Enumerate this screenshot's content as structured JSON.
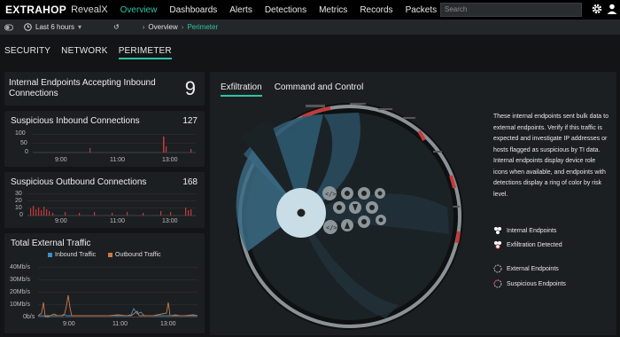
{
  "topbar": {
    "brand": "EXTRAHOP",
    "product": "RevealX",
    "nav": [
      "Overview",
      "Dashboards",
      "Alerts",
      "Detections",
      "Metrics",
      "Records",
      "Packets"
    ],
    "search_placeholder": "Search"
  },
  "subbar": {
    "time_range": "Last 6 hours",
    "crumb_overview": "Overview",
    "crumb_current": "Perimeter"
  },
  "tabs": [
    "SECURITY",
    "NETWORK",
    "PERIMETER"
  ],
  "panels": {
    "inbound_endpoints": {
      "title": "Internal Endpoints Accepting Inbound Connections",
      "count": "9"
    },
    "susp_inbound": {
      "title": "Suspicious Inbound Connections",
      "count": "127",
      "yticks": [
        "100",
        "50",
        "0"
      ],
      "xticks": [
        "9:00",
        "11:00",
        "13:00"
      ]
    },
    "susp_outbound": {
      "title": "Suspicious Outbound Connections",
      "count": "168",
      "yticks": [
        "30",
        "20",
        "10",
        "0"
      ],
      "xticks": [
        "9:00",
        "11:00",
        "13:00"
      ]
    },
    "traffic": {
      "title": "Total External Traffic",
      "legend": [
        "Inbound Traffic",
        "Outbound Traffic"
      ],
      "yticks": [
        "40Mb/s",
        "30Mb/s",
        "20Mb/s",
        "10Mb/s",
        "0b/s"
      ],
      "xticks": [
        "9:00",
        "11:00",
        "13:00"
      ]
    }
  },
  "main": {
    "subtabs": [
      "Exfiltration",
      "Command and Control"
    ],
    "description": "These internal endpoints sent bulk data to external endpoints. Verify if this traffic is expected and investigate IP addresses or hosts flagged as suspicious by TI data. Internal endpoints display device role icons when available, and endpoints with detections display a ring of color by risk level.",
    "legend": [
      "Internal Endpoints",
      "Exfiltration Detected",
      "External Endpoints",
      "Suspicious Endpoints"
    ]
  },
  "colors": {
    "accent": "#2ec4a8",
    "inbound": "#3a8fc9",
    "outbound": "#c97a4a",
    "alert": "#c43a3a"
  }
}
